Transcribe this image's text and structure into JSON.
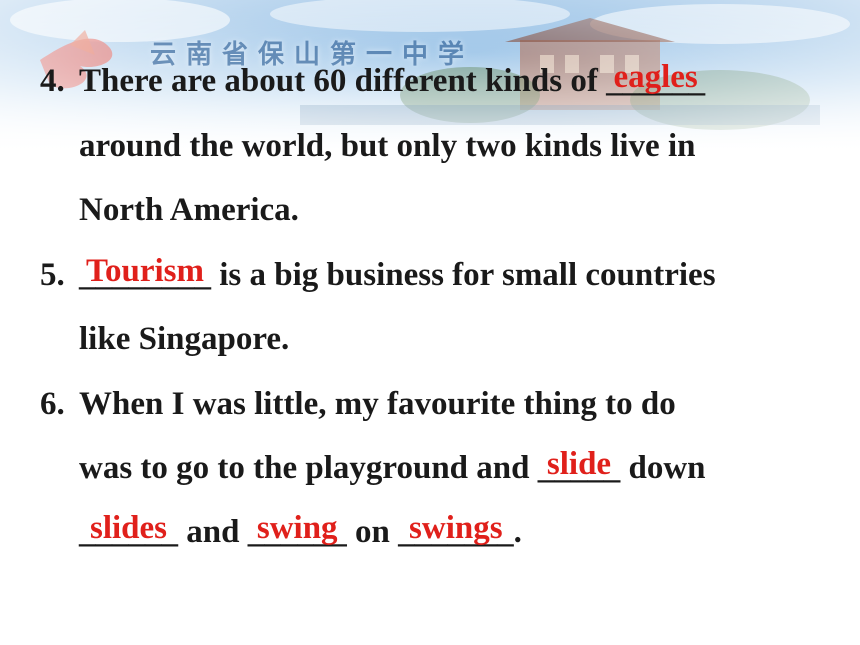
{
  "banner": {
    "school_name": "云南省保山第一中学"
  },
  "colors": {
    "answer": "#e0201b",
    "text": "#1a1a1a",
    "banner_sky": "#9cc4e8"
  },
  "q4": {
    "number": "4.",
    "line1_text": "There are about 60 different kinds of ",
    "blank_underline": "______",
    "answer": "eagles",
    "line2": "around the world, but only two kinds live in",
    "line3": "North America."
  },
  "q5": {
    "number": "5.",
    "blank_underline": "________",
    "answer": "Tourism",
    "line1_rest": " is a big business for small countries",
    "line2": "like Singapore."
  },
  "q6": {
    "number": "6.",
    "line1": "When I was little, my favourite thing to do",
    "line2_text": "was to go to the playground and ",
    "blank1_underline": "_____",
    "answer1": "slide",
    "line2_rest": " down",
    "blank2_underline": "______",
    "answer2": "slides",
    "and_text": " and ",
    "blank3_underline": "______",
    "answer3": "swing",
    "on_text": " on ",
    "blank4_underline": "_______",
    "answer4": "swings",
    "end": "."
  }
}
